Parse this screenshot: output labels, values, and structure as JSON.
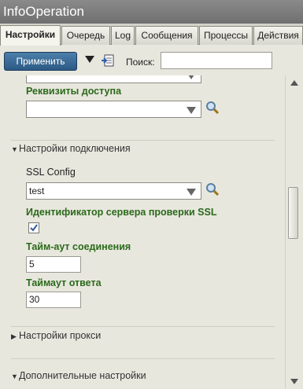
{
  "app": {
    "title": "InfoOperation"
  },
  "tabs": [
    {
      "label": "Настройки",
      "active": true
    },
    {
      "label": "Очередь"
    },
    {
      "label": "Log"
    },
    {
      "label": "Сообщения"
    },
    {
      "label": "Процессы"
    },
    {
      "label": "Действия"
    }
  ],
  "toolbar": {
    "apply_label": "Применить",
    "search_label": "Поиск:",
    "search_value": ""
  },
  "form": {
    "top_combo_value": "",
    "access_label": "Реквизиты доступа",
    "access_value": "",
    "conn_section": "Настройки подключения",
    "ssl_config_label": "SSL Config",
    "ssl_config_value": "test",
    "ssl_server_id_label": "Идентификатор сервера проверки SSL",
    "ssl_server_id_checked": true,
    "conn_timeout_label": "Тайм-аут соединения",
    "conn_timeout_value": "5",
    "resp_timeout_label": "Таймаут ответа",
    "resp_timeout_value": "30",
    "proxy_section": "Настройки прокси",
    "extra_section": "Дополнительные настройки"
  },
  "colors": {
    "accent_label": "#2a6a1a",
    "apply_button": "#3a6b96"
  }
}
